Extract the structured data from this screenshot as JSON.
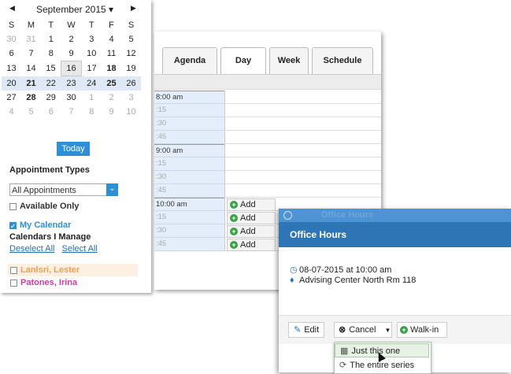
{
  "mini_calendar": {
    "month_label": "September 2015 ▾",
    "weekdays": [
      "S",
      "M",
      "T",
      "W",
      "T",
      "F",
      "S"
    ],
    "weeks": [
      [
        "30",
        "31",
        "1",
        "2",
        "3",
        "4",
        "5"
      ],
      [
        "6",
        "7",
        "8",
        "9",
        "10",
        "11",
        "12"
      ],
      [
        "13",
        "14",
        "15",
        "16",
        "17",
        "18",
        "19"
      ],
      [
        "20",
        "21",
        "22",
        "23",
        "24",
        "25",
        "26"
      ],
      [
        "27",
        "28",
        "29",
        "30",
        "1",
        "2",
        "3"
      ],
      [
        "4",
        "5",
        "6",
        "7",
        "8",
        "9",
        "10"
      ]
    ],
    "today_label": "Today"
  },
  "appointment_types": {
    "title": "Appointment Types",
    "selected": "All Appointments",
    "available_only": "Available Only",
    "my_calendar": "My Calendar",
    "calendars_manage": "Calendars I Manage",
    "deselect_all": "Deselect All",
    "select_all": "Select All",
    "people": [
      {
        "name": "Lanlsri, Lester",
        "color": "#f0a050"
      },
      {
        "name": "Patones, Irina",
        "color": "#d23ca6"
      }
    ]
  },
  "tabs": [
    "Agenda",
    "Day",
    "Week",
    "Schedule"
  ],
  "active_tab": "Day",
  "slots": [
    "8:00 am",
    ":15",
    ":30",
    ":45",
    "9:00 am",
    ":15",
    ":30",
    ":45",
    "10:00 am",
    ":15",
    ":30",
    ":45"
  ],
  "add_label": "Add",
  "popover": {
    "ghost_title": "Office Hours",
    "title": "Office Hours",
    "datetime": "08-07-2015 at 10:00 am",
    "location": "Advising Center North Rm 118",
    "edit": "Edit",
    "cancel": "Cancel",
    "walkin": "Walk-in",
    "menu": [
      "Just this one",
      "The entire series"
    ]
  },
  "colors": {
    "accent": "#2d8fd6",
    "header_blue": "#2e75b6",
    "add_green": "#3aa046"
  }
}
